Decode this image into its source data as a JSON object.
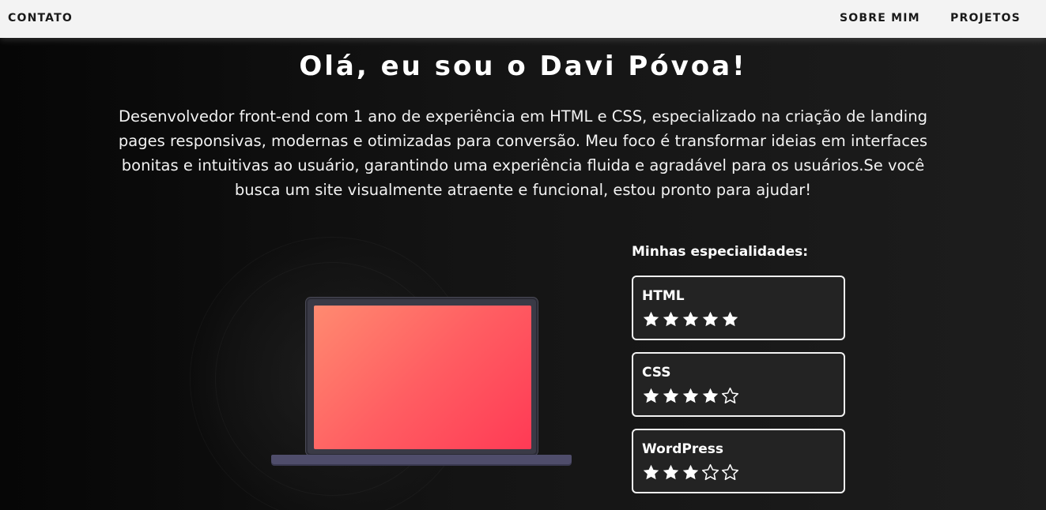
{
  "nav": {
    "contato": "CONTATO",
    "sobre_mim": "SOBRE MIM",
    "projetos": "PROJETOS"
  },
  "hero": {
    "title": "Olá, eu sou o Davi Póvoa!",
    "description": "Desenvolvedor front-end com 1 ano de experiência em HTML e CSS, especializado na criação de landing pages responsivas, modernas e otimizadas para conversão. Meu foco é transformar ideias em interfaces bonitas e intuitivas ao usuário, garantindo uma experiência fluida e agradável para os usuários.Se você busca um site visualmente atraente e funcional, estou pronto para ajudar!"
  },
  "skills": {
    "heading": "Minhas especialidades:",
    "items": [
      {
        "name": "HTML",
        "rating": 5,
        "max": 5
      },
      {
        "name": "CSS",
        "rating": 4,
        "max": 5
      },
      {
        "name": "WordPress",
        "rating": 3,
        "max": 5
      }
    ]
  },
  "colors": {
    "nav_bg": "#f3f3f3",
    "page_bg": "#111111",
    "screen_gradient_start": "#ff8a70",
    "screen_gradient_end": "#ff3a55",
    "laptop_base": "#4f4d6b",
    "card_border": "#f2f2f2"
  },
  "icons": {
    "star_filled": "star-filled-icon",
    "star_empty": "star-outline-icon",
    "laptop": "laptop-illustration"
  }
}
